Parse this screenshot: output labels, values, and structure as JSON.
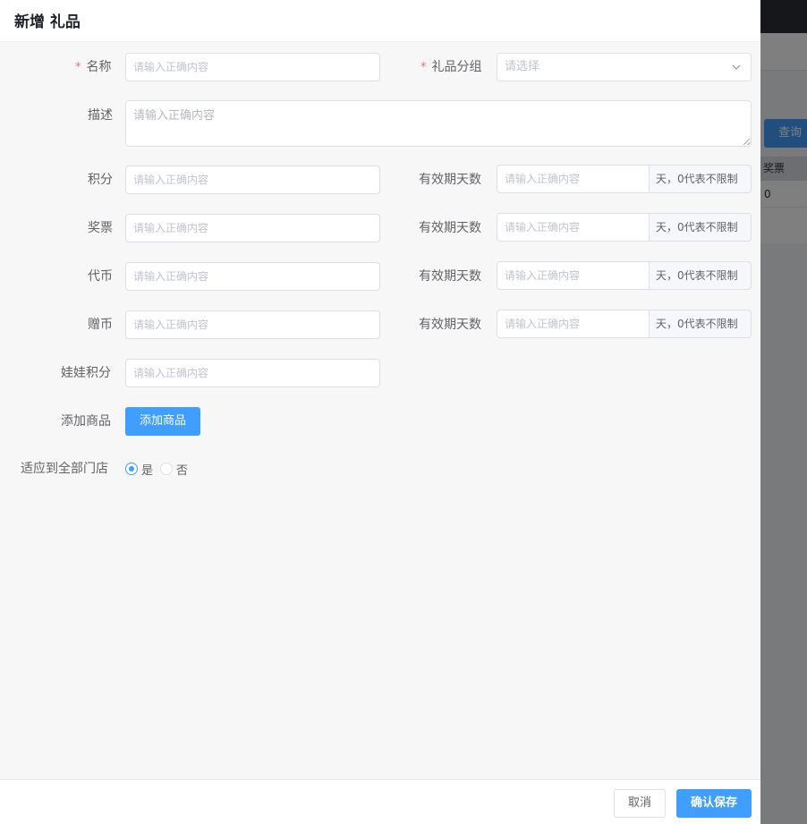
{
  "background": {
    "query_button": "查询",
    "table_header": "奖票",
    "table_cell": "0"
  },
  "drawer": {
    "title": "新增 礼品",
    "placeholder": "请输入正确内容",
    "select_placeholder": "请选择",
    "fields": {
      "name": "名称",
      "category": "礼品分组",
      "description": "描述",
      "points": "积分",
      "tickets": "奖票",
      "tokens": "代币",
      "bonus_coins": "赠币",
      "doll_points": "娃娃积分",
      "add_product": "添加商品",
      "all_stores": "适应到全部门店"
    },
    "validity_label": "有效期天数",
    "validity_suffix": "天，0代表不限制",
    "add_product_button": "添加商品",
    "radio": {
      "yes": "是",
      "no": "否",
      "selected": "是"
    }
  },
  "footer": {
    "cancel": "取消",
    "confirm": "确认保存"
  },
  "colors": {
    "accent": "#409eff",
    "required": "#f56c6c"
  }
}
